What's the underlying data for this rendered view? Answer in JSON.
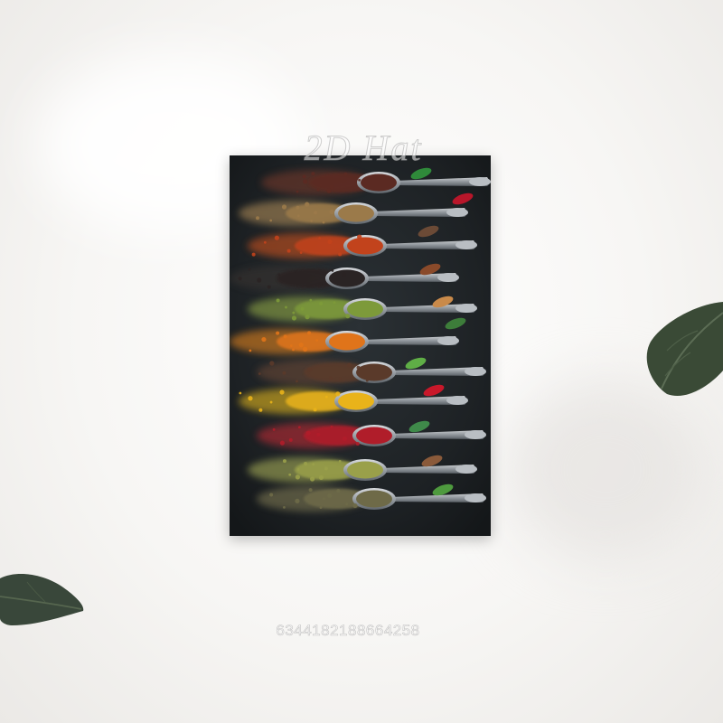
{
  "scene": {
    "background_color": "#f4f3f1",
    "poster_background": "#1d2124",
    "subject": "spice-spoons-poster"
  },
  "watermarks": {
    "top": "2D Hat",
    "bottom": "6344182188664258"
  }
}
